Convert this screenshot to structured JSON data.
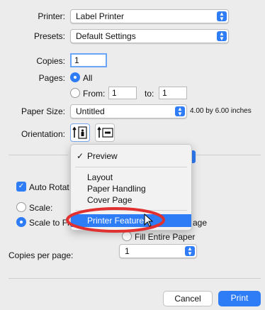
{
  "printer": {
    "label": "Printer:",
    "value": "Label Printer"
  },
  "presets": {
    "label": "Presets:",
    "value": "Default Settings"
  },
  "copies": {
    "label": "Copies:",
    "value": "1"
  },
  "pages": {
    "label": "Pages:",
    "all": "All",
    "from_label": "From:",
    "from_value": "1",
    "to_label": "to:",
    "to_value": "1"
  },
  "paper_size": {
    "label": "Paper Size:",
    "value": "Untitled",
    "dimensions": "4.00 by 6.00 inches"
  },
  "orientation": {
    "label": "Orientation:"
  },
  "menu": {
    "check": "✓",
    "items": [
      "Preview",
      "Layout",
      "Paper Handling",
      "Cover Page",
      "Printer Features"
    ]
  },
  "options": {
    "auto_rotate": "Auto Rotat",
    "scale": "Scale:",
    "scale_to_fit": "Scale to Fi",
    "age_fragment": "age",
    "fill_entire_paper": "Fill Entire Paper"
  },
  "copies_per_page": {
    "label": "Copies per page:",
    "value": "1"
  },
  "buttons": {
    "cancel": "Cancel",
    "print": "Print"
  },
  "colors": {
    "accent": "#2e7cf6",
    "annotation": "#e03030"
  }
}
